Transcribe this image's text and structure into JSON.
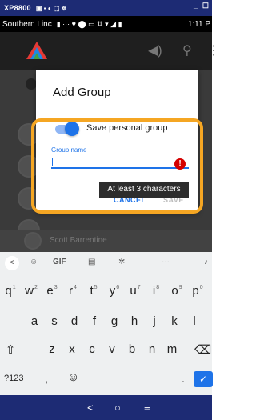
{
  "device": {
    "name": "XP8800",
    "status_icons": "▣ ▪ ◐ ⬚ ✲",
    "minimize": "_",
    "close": "☐"
  },
  "status_bar": {
    "carrier": "Southern Linc",
    "icons": "▮  ···  ♥ ⬤ ▭ ⇅ ▾ ◢ ▮",
    "time": "1:11 P"
  },
  "app_bar": {
    "volume_icon": "volume-icon",
    "search_icon": "search-icon",
    "menu_icon": "more-vert-icon"
  },
  "background_contact": {
    "name": "Scott Barrentine"
  },
  "dialog": {
    "title": "Add Group",
    "toggle_label": "Save personal group",
    "toggle_on": true,
    "field_label": "Group name",
    "field_value": "",
    "cancel_label": "CANCEL",
    "save_label": "SAVE",
    "error_glyph": "!"
  },
  "tooltip": {
    "text": "At least 3 characters"
  },
  "keyboard": {
    "toolbar": {
      "back": "<",
      "sticker": "☺",
      "gif": "GIF",
      "clipboard": "▤",
      "settings": "✲",
      "more": "···",
      "mic": "♪"
    },
    "row1": [
      {
        "k": "q",
        "n": "1"
      },
      {
        "k": "w",
        "n": "2"
      },
      {
        "k": "e",
        "n": "3"
      },
      {
        "k": "r",
        "n": "4"
      },
      {
        "k": "t",
        "n": "5"
      },
      {
        "k": "y",
        "n": "6"
      },
      {
        "k": "u",
        "n": "7"
      },
      {
        "k": "i",
        "n": "8"
      },
      {
        "k": "o",
        "n": "9"
      },
      {
        "k": "p",
        "n": "0"
      }
    ],
    "row2": [
      "a",
      "s",
      "d",
      "f",
      "g",
      "h",
      "j",
      "k",
      "l"
    ],
    "row3": [
      "z",
      "x",
      "c",
      "v",
      "b",
      "n",
      "m"
    ],
    "shift": "⇧",
    "backspace": "⌫",
    "symbols": "?123",
    "comma": ",",
    "emoji": "☺",
    "period": ".",
    "enter": "✓"
  },
  "nav_bar": {
    "back": "<",
    "home": "○",
    "menu": "≡"
  },
  "colors": {
    "accent": "#1e73e8",
    "highlight": "#f5a623",
    "error": "#d50000",
    "nav": "#1d2b74"
  }
}
